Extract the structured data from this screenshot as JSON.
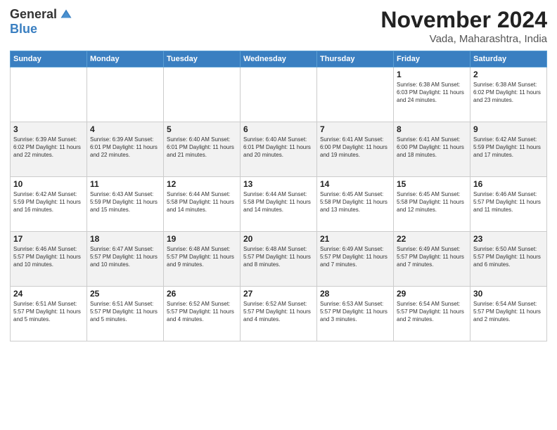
{
  "logo": {
    "general": "General",
    "blue": "Blue"
  },
  "title": "November 2024",
  "location": "Vada, Maharashtra, India",
  "days_of_week": [
    "Sunday",
    "Monday",
    "Tuesday",
    "Wednesday",
    "Thursday",
    "Friday",
    "Saturday"
  ],
  "weeks": [
    [
      {
        "day": "",
        "info": ""
      },
      {
        "day": "",
        "info": ""
      },
      {
        "day": "",
        "info": ""
      },
      {
        "day": "",
        "info": ""
      },
      {
        "day": "",
        "info": ""
      },
      {
        "day": "1",
        "info": "Sunrise: 6:38 AM\nSunset: 6:03 PM\nDaylight: 11 hours and 24 minutes."
      },
      {
        "day": "2",
        "info": "Sunrise: 6:38 AM\nSunset: 6:02 PM\nDaylight: 11 hours and 23 minutes."
      }
    ],
    [
      {
        "day": "3",
        "info": "Sunrise: 6:39 AM\nSunset: 6:02 PM\nDaylight: 11 hours and 22 minutes."
      },
      {
        "day": "4",
        "info": "Sunrise: 6:39 AM\nSunset: 6:01 PM\nDaylight: 11 hours and 22 minutes."
      },
      {
        "day": "5",
        "info": "Sunrise: 6:40 AM\nSunset: 6:01 PM\nDaylight: 11 hours and 21 minutes."
      },
      {
        "day": "6",
        "info": "Sunrise: 6:40 AM\nSunset: 6:01 PM\nDaylight: 11 hours and 20 minutes."
      },
      {
        "day": "7",
        "info": "Sunrise: 6:41 AM\nSunset: 6:00 PM\nDaylight: 11 hours and 19 minutes."
      },
      {
        "day": "8",
        "info": "Sunrise: 6:41 AM\nSunset: 6:00 PM\nDaylight: 11 hours and 18 minutes."
      },
      {
        "day": "9",
        "info": "Sunrise: 6:42 AM\nSunset: 5:59 PM\nDaylight: 11 hours and 17 minutes."
      }
    ],
    [
      {
        "day": "10",
        "info": "Sunrise: 6:42 AM\nSunset: 5:59 PM\nDaylight: 11 hours and 16 minutes."
      },
      {
        "day": "11",
        "info": "Sunrise: 6:43 AM\nSunset: 5:59 PM\nDaylight: 11 hours and 15 minutes."
      },
      {
        "day": "12",
        "info": "Sunrise: 6:44 AM\nSunset: 5:58 PM\nDaylight: 11 hours and 14 minutes."
      },
      {
        "day": "13",
        "info": "Sunrise: 6:44 AM\nSunset: 5:58 PM\nDaylight: 11 hours and 14 minutes."
      },
      {
        "day": "14",
        "info": "Sunrise: 6:45 AM\nSunset: 5:58 PM\nDaylight: 11 hours and 13 minutes."
      },
      {
        "day": "15",
        "info": "Sunrise: 6:45 AM\nSunset: 5:58 PM\nDaylight: 11 hours and 12 minutes."
      },
      {
        "day": "16",
        "info": "Sunrise: 6:46 AM\nSunset: 5:57 PM\nDaylight: 11 hours and 11 minutes."
      }
    ],
    [
      {
        "day": "17",
        "info": "Sunrise: 6:46 AM\nSunset: 5:57 PM\nDaylight: 11 hours and 10 minutes."
      },
      {
        "day": "18",
        "info": "Sunrise: 6:47 AM\nSunset: 5:57 PM\nDaylight: 11 hours and 10 minutes."
      },
      {
        "day": "19",
        "info": "Sunrise: 6:48 AM\nSunset: 5:57 PM\nDaylight: 11 hours and 9 minutes."
      },
      {
        "day": "20",
        "info": "Sunrise: 6:48 AM\nSunset: 5:57 PM\nDaylight: 11 hours and 8 minutes."
      },
      {
        "day": "21",
        "info": "Sunrise: 6:49 AM\nSunset: 5:57 PM\nDaylight: 11 hours and 7 minutes."
      },
      {
        "day": "22",
        "info": "Sunrise: 6:49 AM\nSunset: 5:57 PM\nDaylight: 11 hours and 7 minutes."
      },
      {
        "day": "23",
        "info": "Sunrise: 6:50 AM\nSunset: 5:57 PM\nDaylight: 11 hours and 6 minutes."
      }
    ],
    [
      {
        "day": "24",
        "info": "Sunrise: 6:51 AM\nSunset: 5:57 PM\nDaylight: 11 hours and 5 minutes."
      },
      {
        "day": "25",
        "info": "Sunrise: 6:51 AM\nSunset: 5:57 PM\nDaylight: 11 hours and 5 minutes."
      },
      {
        "day": "26",
        "info": "Sunrise: 6:52 AM\nSunset: 5:57 PM\nDaylight: 11 hours and 4 minutes."
      },
      {
        "day": "27",
        "info": "Sunrise: 6:52 AM\nSunset: 5:57 PM\nDaylight: 11 hours and 4 minutes."
      },
      {
        "day": "28",
        "info": "Sunrise: 6:53 AM\nSunset: 5:57 PM\nDaylight: 11 hours and 3 minutes."
      },
      {
        "day": "29",
        "info": "Sunrise: 6:54 AM\nSunset: 5:57 PM\nDaylight: 11 hours and 2 minutes."
      },
      {
        "day": "30",
        "info": "Sunrise: 6:54 AM\nSunset: 5:57 PM\nDaylight: 11 hours and 2 minutes."
      }
    ]
  ]
}
